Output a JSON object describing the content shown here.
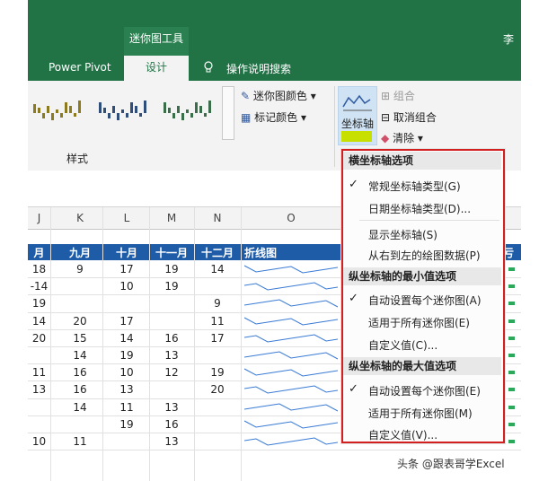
{
  "ribbon": {
    "context_title": "迷你图工具",
    "user_initial": "李",
    "tabs": [
      "Power Pivot",
      "设计",
      "操作说明搜索"
    ],
    "style_group_label": "样式",
    "sparkline_color": "迷你图颜色",
    "marker_color": "标记颜色",
    "axis_button": "坐标轴",
    "group": "组合",
    "ungroup": "取消组合",
    "clear": "清除"
  },
  "sheet": {
    "column_letters": [
      "J",
      "K",
      "L",
      "M",
      "N",
      "O"
    ],
    "headers": [
      "月",
      "九月",
      "十月",
      "十一月",
      "十二月",
      "折线图",
      "亏盈"
    ],
    "rows": [
      [
        "18",
        "9",
        "17",
        "19",
        "14"
      ],
      [
        "-14",
        "",
        "10",
        "19",
        ""
      ],
      [
        "19",
        "",
        "",
        "",
        "9"
      ],
      [
        "14",
        "20",
        "17",
        "",
        "11"
      ],
      [
        "20",
        "15",
        "14",
        "16",
        "17"
      ],
      [
        "",
        "14",
        "19",
        "13",
        ""
      ],
      [
        "11",
        "16",
        "10",
        "12",
        "19"
      ],
      [
        "13",
        "16",
        "13",
        "",
        "20"
      ],
      [
        "",
        "14",
        "11",
        "13",
        ""
      ],
      [
        "",
        "",
        "19",
        "16",
        ""
      ],
      [
        "10",
        "11",
        "",
        "13",
        ""
      ]
    ]
  },
  "menu": {
    "section1": "横坐标轴选项",
    "item_general_axis": "常规坐标轴类型(G)",
    "item_date_axis": "日期坐标轴类型(D)...",
    "item_show_axis": "显示坐标轴(S)",
    "item_rtl": "从右到左的绘图数据(P)",
    "section2": "纵坐标轴的最小值选项",
    "item_min_auto": "自动设置每个迷你图(A)",
    "item_min_same": "适用于所有迷你图(E)",
    "item_min_custom": "自定义值(C)...",
    "section3": "纵坐标轴的最大值选项",
    "item_max_auto": "自动设置每个迷你图(E)",
    "item_max_same": "适用于所有迷你图(M)",
    "item_max_custom": "自定义值(V)..."
  },
  "watermark": "头条 @跟表哥学Excel",
  "colors": {
    "excel_green": "#217346",
    "header_blue": "#1f5ca8",
    "highlight_red": "#d21f1f"
  }
}
